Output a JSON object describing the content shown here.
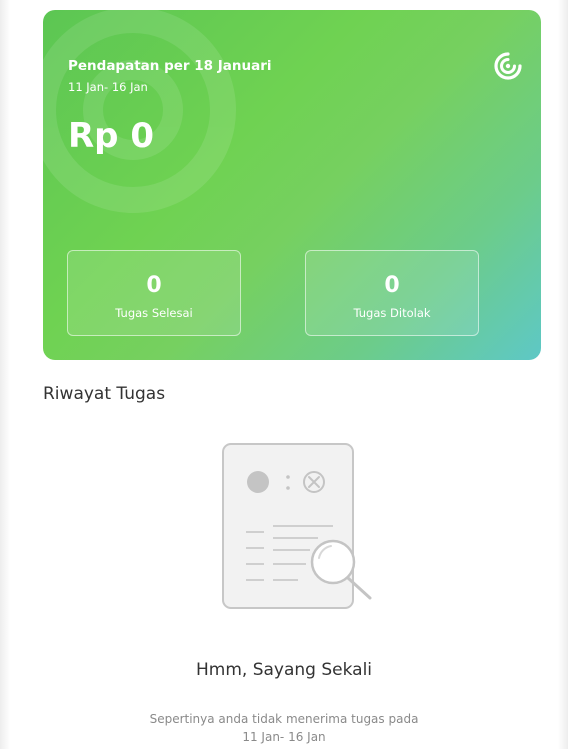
{
  "earnings_card": {
    "title": "Pendapatan per 18 Januari",
    "period": "11 Jan- 16 Jan",
    "amount": "Rp 0",
    "brand_icon": "spiral-logo-icon",
    "stats": [
      {
        "value": "0",
        "label": "Tugas Selesai"
      },
      {
        "value": "0",
        "label": "Tugas Ditolak"
      }
    ],
    "gradient_colors": [
      "#5cc653",
      "#76d060",
      "#5ec8c6"
    ]
  },
  "history": {
    "title": "Riwayat Tugas",
    "empty_state": {
      "icon": "empty-document-search-icon",
      "title": "Hmm, Sayang Sekali",
      "description_line1": "Sepertinya anda tidak menerima tugas pada",
      "description_line2": "11 Jan- 16 Jan"
    }
  }
}
